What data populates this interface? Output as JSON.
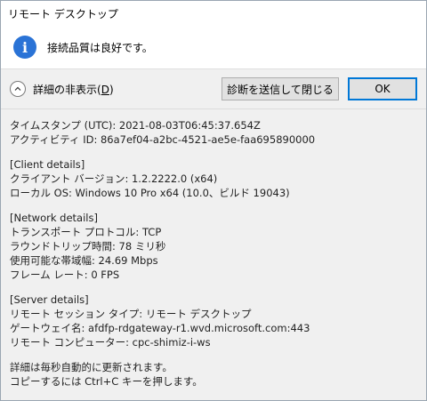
{
  "window": {
    "title": "リモート デスクトップ"
  },
  "header": {
    "message": "接続品質は良好です。"
  },
  "actions": {
    "toggle_label_prefix": "詳細の非表示(",
    "toggle_key": "D",
    "toggle_label_suffix": ")",
    "diagnostics_button": "診断を送信して閉じる",
    "ok_button": "OK"
  },
  "details": {
    "timestamp": "タイムスタンプ (UTC): 2021-08-03T06:45:37.654Z",
    "activity_id": "アクティビティ ID: 86a7ef04-a2bc-4521-ae5e-faa695890000",
    "client_header": "[Client details]",
    "client_version": "クライアント バージョン: 1.2.2222.0 (x64)",
    "local_os": "ローカル OS: Windows 10 Pro x64 (10.0、ビルド 19043)",
    "network_header": "[Network details]",
    "transport": "トランスポート プロトコル: TCP",
    "rtt": "ラウンドトリップ時間: 78 ミリ秒",
    "bandwidth": "使用可能な帯域幅: 24.69 Mbps",
    "frame_rate": "フレーム レート: 0 FPS",
    "server_header": "[Server details]",
    "session_type": "リモート セッション タイプ: リモート デスクトップ",
    "gateway": "ゲートウェイ名: afdfp-rdgateway-r1.wvd.microsoft.com:443",
    "remote_computer": "リモート コンピューター: cpc-shimiz-i-ws",
    "auto_update": "詳細は毎秒自動的に更新されます。",
    "copy_hint": "コピーするには Ctrl+C キーを押します。"
  },
  "colors": {
    "info_icon": "#2a73d6",
    "ok_border": "#0078d7"
  },
  "icons": {
    "header": "info-icon",
    "toggle": "chevron-up-icon"
  }
}
